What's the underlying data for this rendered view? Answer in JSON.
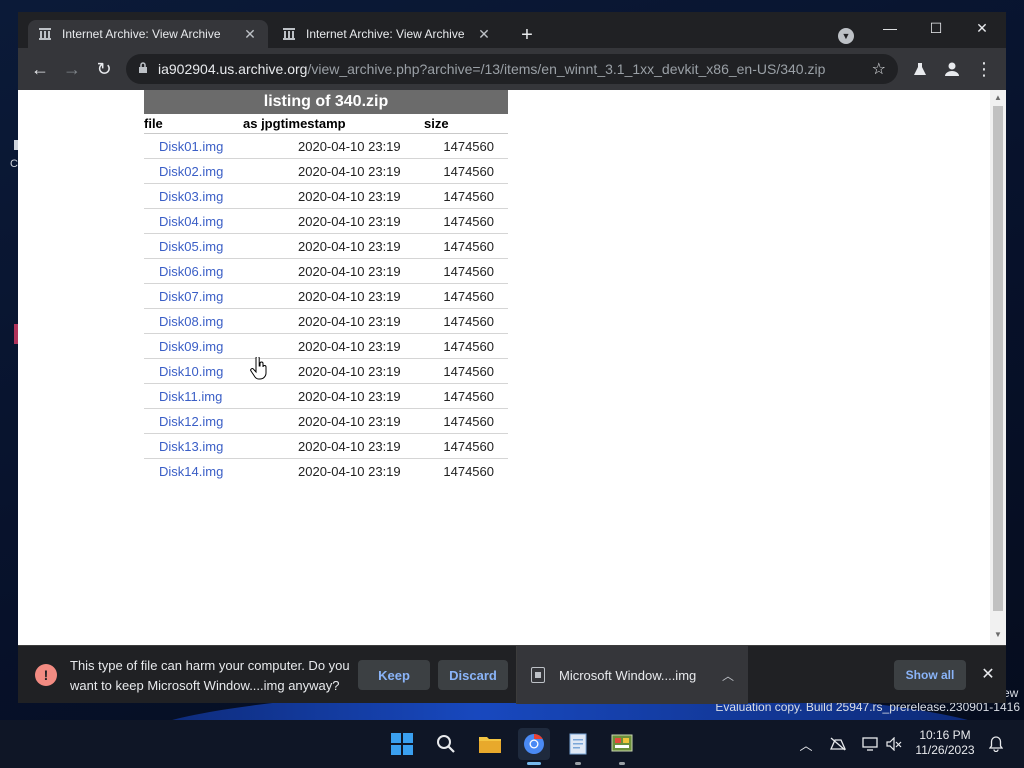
{
  "window": {
    "tabs": [
      {
        "title": "Internet Archive: View Archive",
        "active": true
      },
      {
        "title": "Internet Archive: View Archive",
        "active": false
      }
    ]
  },
  "address_bar": {
    "host": "ia902904.us.archive.org",
    "path": "/view_archive.php?archive=/13/items/en_winnt_3.1_1xx_devkit_x86_en-US/340.zip"
  },
  "listing": {
    "title": "listing of 340.zip",
    "columns": [
      "file",
      "as jpg",
      "timestamp",
      "size"
    ],
    "rows": [
      {
        "file": "Disk01.img",
        "timestamp": "2020-04-10 23:19",
        "size": "1474560"
      },
      {
        "file": "Disk02.img",
        "timestamp": "2020-04-10 23:19",
        "size": "1474560"
      },
      {
        "file": "Disk03.img",
        "timestamp": "2020-04-10 23:19",
        "size": "1474560"
      },
      {
        "file": "Disk04.img",
        "timestamp": "2020-04-10 23:19",
        "size": "1474560"
      },
      {
        "file": "Disk05.img",
        "timestamp": "2020-04-10 23:19",
        "size": "1474560"
      },
      {
        "file": "Disk06.img",
        "timestamp": "2020-04-10 23:19",
        "size": "1474560"
      },
      {
        "file": "Disk07.img",
        "timestamp": "2020-04-10 23:19",
        "size": "1474560"
      },
      {
        "file": "Disk08.img",
        "timestamp": "2020-04-10 23:19",
        "size": "1474560"
      },
      {
        "file": "Disk09.img",
        "timestamp": "2020-04-10 23:19",
        "size": "1474560"
      },
      {
        "file": "Disk10.img",
        "timestamp": "2020-04-10 23:19",
        "size": "1474560"
      },
      {
        "file": "Disk11.img",
        "timestamp": "2020-04-10 23:19",
        "size": "1474560"
      },
      {
        "file": "Disk12.img",
        "timestamp": "2020-04-10 23:19",
        "size": "1474560"
      },
      {
        "file": "Disk13.img",
        "timestamp": "2020-04-10 23:19",
        "size": "1474560"
      },
      {
        "file": "Disk14.img",
        "timestamp": "2020-04-10 23:19",
        "size": "1474560"
      }
    ]
  },
  "download_bar": {
    "warning": "This type of file can harm your computer. Do you want to keep Microsoft Window....img anyway?",
    "keep_label": "Keep",
    "discard_label": "Discard",
    "file_name": "Microsoft Window....img",
    "show_all_label": "Show all"
  },
  "desktop": {
    "eval_suffix": "ew",
    "eval_text": "Evaluation copy. Build 25947.rs_prerelease.230901-1416"
  },
  "taskbar": {
    "time": "10:16 PM",
    "date": "11/26/2023"
  },
  "icons": {
    "tab_favicon": "archive-icon",
    "warning": "warning-icon",
    "file": "file-icon"
  },
  "colors": {
    "link": "#3a5ec6",
    "listing_title_bg": "#6b6b6b",
    "accent_button_text": "#8ab4f8",
    "warning_icon": "#f28b82"
  }
}
